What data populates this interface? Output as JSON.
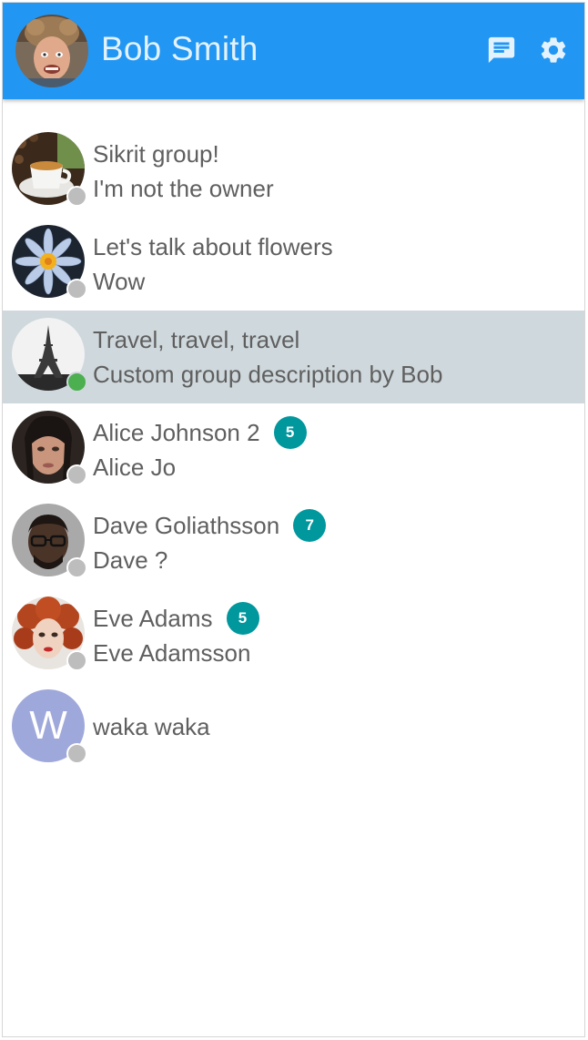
{
  "header": {
    "title": "Bob Smith",
    "color": "#2196f3",
    "actions": [
      {
        "icon": "chat-icon"
      },
      {
        "icon": "gear-icon"
      }
    ]
  },
  "contacts": [
    {
      "name": "Sikrit group!",
      "subtitle": "I'm not the owner",
      "badge": "",
      "status": "offline",
      "selected": false,
      "avatar": "coffee-photo"
    },
    {
      "name": "Let's talk about flowers",
      "subtitle": "Wow",
      "badge": "",
      "status": "offline",
      "selected": false,
      "avatar": "flower-photo"
    },
    {
      "name": "Travel, travel, travel",
      "subtitle": "Custom group description by Bob",
      "badge": "",
      "status": "online",
      "selected": true,
      "avatar": "eiffel-tower-photo"
    },
    {
      "name": "Alice Johnson 2",
      "subtitle": "Alice Jo",
      "badge": "5",
      "status": "offline",
      "selected": false,
      "avatar": "alice-photo"
    },
    {
      "name": "Dave Goliathsson",
      "subtitle": "Dave ?",
      "badge": "7",
      "status": "offline",
      "selected": false,
      "avatar": "dave-photo"
    },
    {
      "name": "Eve Adams",
      "subtitle": "Eve Adamsson",
      "badge": "5",
      "status": "offline",
      "selected": false,
      "avatar": "eve-photo"
    },
    {
      "name": "waka waka",
      "subtitle": "",
      "badge": "",
      "status": "offline",
      "selected": false,
      "avatar": "letter-avatar",
      "avatar_letter": "W"
    }
  ],
  "colors": {
    "selected_row": "#cfd8dc",
    "badge": "#00979d",
    "online": "#4caf50",
    "offline": "#bdbdbd"
  }
}
